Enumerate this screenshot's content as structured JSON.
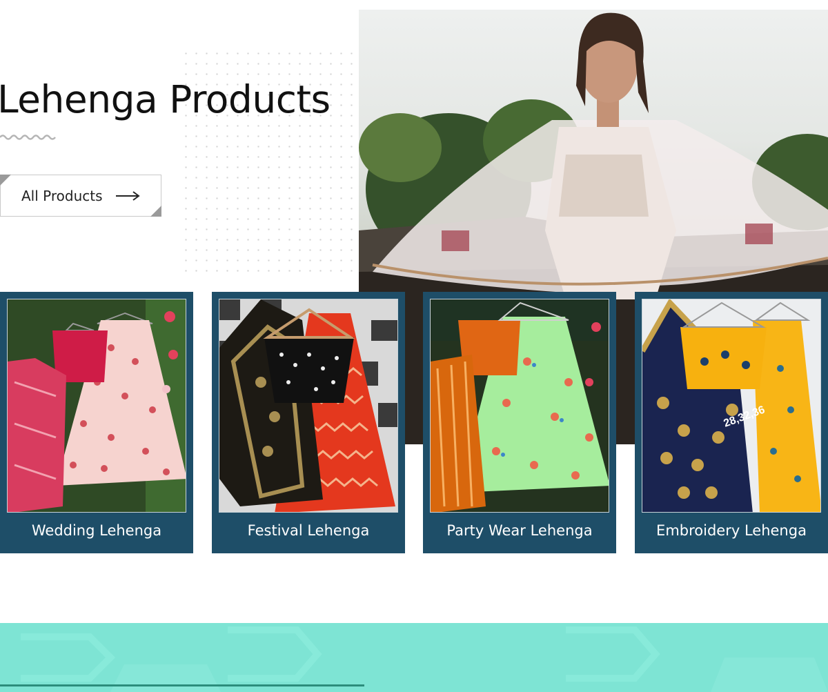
{
  "section": {
    "title": "Lehenga Products",
    "all_products_label": "All Products"
  },
  "cards": [
    {
      "label": "Wedding Lehenga"
    },
    {
      "label": "Festival Lehenga"
    },
    {
      "label": "Party Wear Lehenga"
    },
    {
      "label": "Embroidery Lehenga"
    }
  ],
  "card4_tag": "28,32,36",
  "colors": {
    "card_bg": "#1e4e68",
    "band_bg": "#7ee4d4",
    "band_line": "#2c8d7c"
  }
}
